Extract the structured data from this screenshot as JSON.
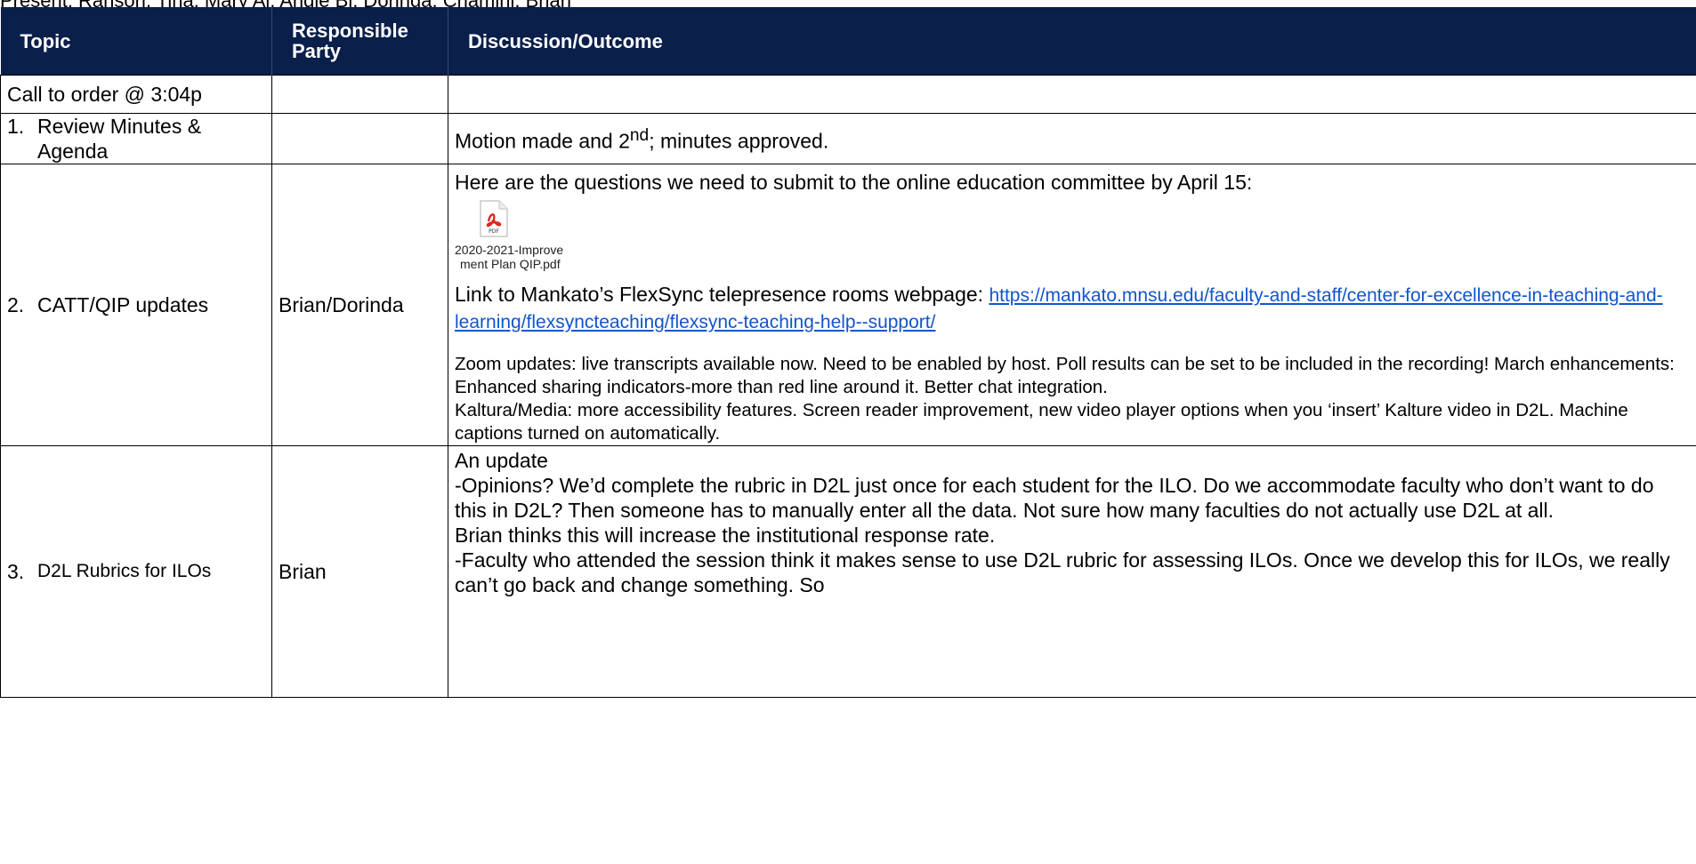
{
  "present": "Present: Ranson, Tina, Mary Al, Angie Bi, Dorinda, Chamini, Brian",
  "headers": {
    "topic": "Topic",
    "responsible": "Responsible Party",
    "discussion": "Discussion/Outcome"
  },
  "rows": {
    "call": {
      "topic": "Call to order @ 3:04p"
    },
    "review": {
      "num": "1.",
      "topic": "Review Minutes & Agenda",
      "outcome_pre": "Motion made and 2",
      "outcome_sup": "nd",
      "outcome_post": "; minutes approved."
    },
    "catt": {
      "num": "2.",
      "topic": "CATT/QIP updates",
      "responsible": "Brian/Dorinda",
      "intro": "Here are the questions we need to submit to the online education committee by April 15:",
      "attachment": {
        "icon": "pdf-file-icon",
        "name_line1": "2020-2021-Improve",
        "name_line2": "ment Plan QIP.pdf"
      },
      "link_label": "Link to Mankato’s FlexSync telepresence rooms webpage: ",
      "link_url": "https://mankato.mnsu.edu/faculty-and-staff/center-for-excellence-in-teaching-and-learning/flexsyncteaching/flexsync-teaching-help--support/",
      "zoom": "Zoom updates: live transcripts available now. Need to be enabled by host. Poll results can be set to be included in the recording! March enhancements: Enhanced sharing indicators-more than red line around it. Better chat integration.",
      "kaltura": "Kaltura/Media: more accessibility features. Screen reader improvement, new video player options when you ‘insert’ Kalture video in D2L. Machine captions turned on automatically."
    },
    "rubric": {
      "num": "3.",
      "topic": "D2L Rubrics for ILOs",
      "responsible": "Brian",
      "line1": "An update",
      "line2": "-Opinions? We’d complete the rubric in D2L just once for each student for the ILO. Do we accommodate faculty who don’t want to do this in D2L? Then someone has to manually enter all the data. Not sure how many faculties do not actually use D2L at all.",
      "line3": "Brian thinks this will increase the institutional response rate.",
      "line4": "-Faculty who attended the session think it makes sense to use D2L rubric for assessing ILOs. Once we develop this for ILOs, we really can’t go back and change something. So"
    }
  },
  "colors": {
    "header_bg": "#0a1f4a",
    "link": "#1155cc",
    "pdf_red": "#e2211c"
  }
}
